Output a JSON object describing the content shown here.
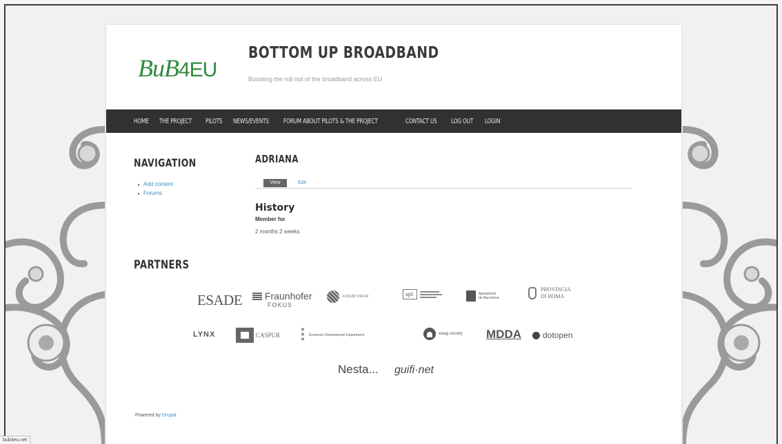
{
  "site": {
    "logo_part1": "BuB",
    "logo_part2": "4EU",
    "name": "BOTTOM UP BROADBAND",
    "slogan": "Boosting the roll out of the broadband across EU"
  },
  "nav_menu": [
    {
      "label": "HOME"
    },
    {
      "label": "THE PROJECT"
    },
    {
      "label": "PILOTS"
    },
    {
      "label": "NEWS/EVENTS"
    },
    {
      "label": "FORUM ABOUT PILOTS & THE PROJECT"
    },
    {
      "label": "CONTACT US"
    },
    {
      "label": "LOG OUT"
    },
    {
      "label": "LOGIN"
    }
  ],
  "navigation_block": {
    "title": "NAVIGATION",
    "items": [
      {
        "label": "Add content"
      },
      {
        "label": "Forums"
      }
    ]
  },
  "profile": {
    "title": "ADRIANA",
    "tabs": {
      "view": "View",
      "edit": "Edit"
    },
    "history_title": "History",
    "member_for_label": "Member for",
    "member_for_value": "2 months 2 weeks"
  },
  "partners": {
    "title": "PARTNERS",
    "logos": {
      "esade": "ESADE",
      "fraunhofer": "Fraunhofer",
      "fokus": "FOKUS",
      "forum_virium": "FORUM VIRIUM",
      "upf": "upf.",
      "ajuntament_1": "Ajuntament",
      "ajuntament_2": "de Barcelona",
      "provincia_1": "PROVINCIA",
      "provincia_2": "DI ROMA",
      "lynx": "LYNX",
      "caspur": "CASPUR",
      "amsterdam": "Economic Development Department",
      "waag": "waag society",
      "mdda": "MDDA",
      "dotopen": "dotopen",
      "nesta": "Nesta...",
      "guifi": "guifi·net"
    }
  },
  "footer": {
    "text": "Powered by",
    "link": "Drupal"
  },
  "status_bar": "bub4eu.net",
  "colors": {
    "navbar": "#313131",
    "logo_green": "#2f8a3c",
    "link": "#3b8fc6",
    "page_bg": "#ffffff",
    "outer_bg": "#f1f1f1"
  }
}
